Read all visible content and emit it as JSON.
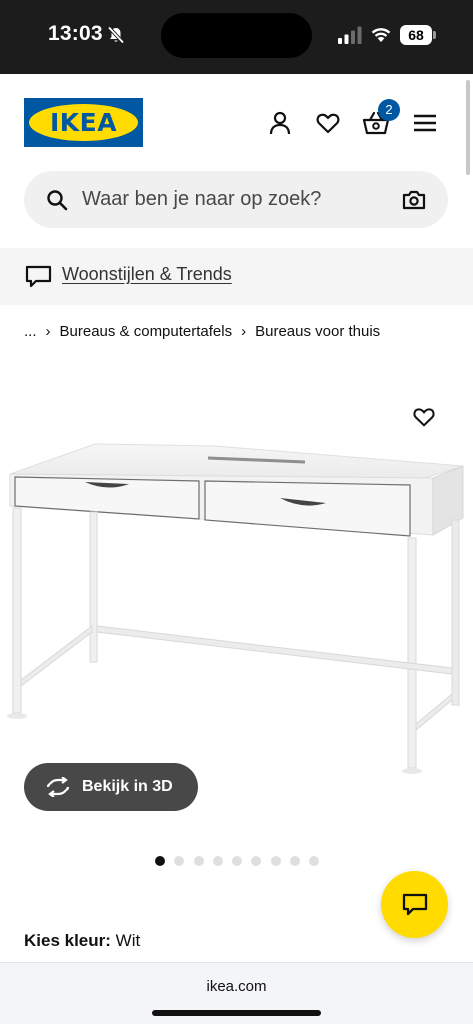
{
  "status_bar": {
    "time": "13:03",
    "battery": "68",
    "icons": [
      "bell-mute-icon",
      "signal-icon",
      "wifi-icon",
      "battery-icon"
    ]
  },
  "header": {
    "logo_text": "IKEA",
    "cart_count": "2",
    "icons": [
      "user-icon",
      "heart-icon",
      "basket-icon",
      "menu-icon"
    ],
    "colors": {
      "brand_blue": "#0058a3",
      "brand_yellow": "#ffdb00"
    }
  },
  "search": {
    "placeholder": "Waar ben je naar op zoek?",
    "value": ""
  },
  "banner": {
    "link_text": "Woonstijlen & Trends"
  },
  "breadcrumb": {
    "items": [
      "...",
      "Bureaus & computertafels",
      "Bureaus voor thuis"
    ]
  },
  "product": {
    "view_3d_label": "Bekijk in 3D",
    "image_count": 9,
    "active_image": 1,
    "color_label": "Kies kleur:",
    "color_value": "Wit"
  },
  "browser": {
    "url": "ikea.com"
  }
}
